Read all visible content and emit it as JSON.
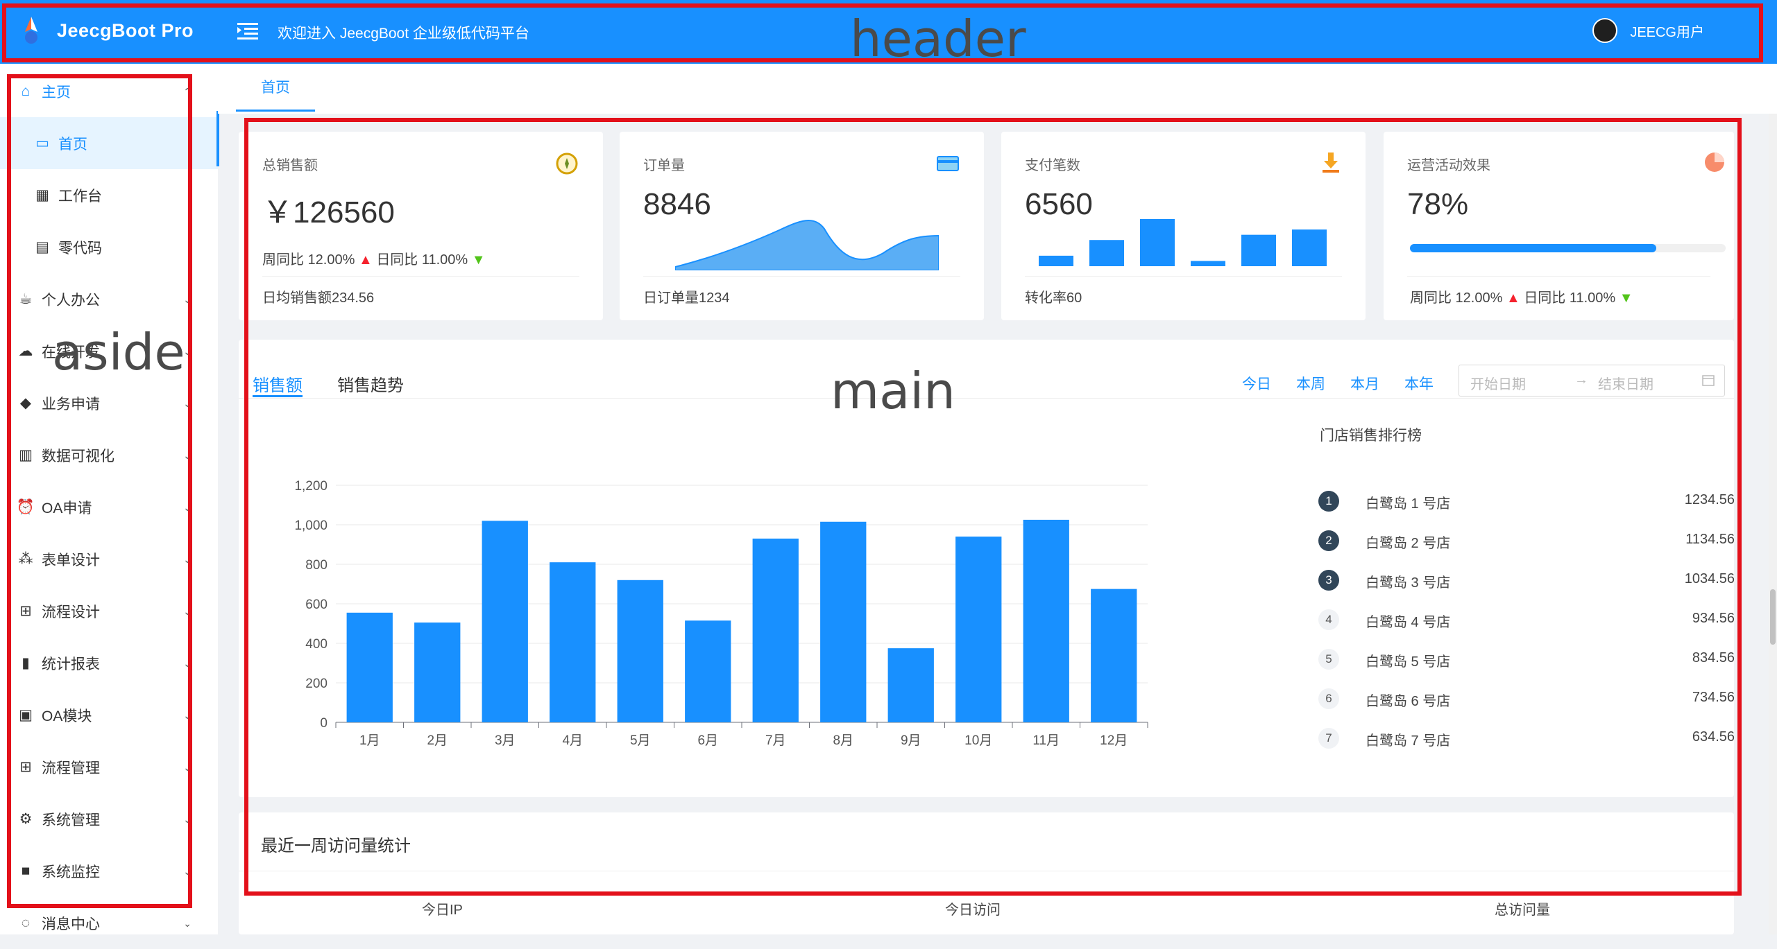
{
  "header": {
    "app_title": "JeecgBoot Pro",
    "welcome_text": "欢迎进入 JeecgBoot 企业级低代码平台",
    "user_name": "JEECG用户"
  },
  "annotations": {
    "header": "header",
    "aside": "aside",
    "main": "main"
  },
  "sidebar": {
    "items": [
      {
        "label": "主页",
        "icon": "home-icon"
      },
      {
        "label": "首页",
        "icon": "dashboard-icon"
      },
      {
        "label": "工作台",
        "icon": "grid-icon"
      },
      {
        "label": "零代码",
        "icon": "table-icon"
      },
      {
        "label": "个人办公",
        "icon": "coffee-icon"
      },
      {
        "label": "在线开发",
        "icon": "cloud-icon"
      },
      {
        "label": "业务申请",
        "icon": "tag-icon"
      },
      {
        "label": "数据可视化",
        "icon": "layout-icon"
      },
      {
        "label": "OA申请",
        "icon": "alarm-icon"
      },
      {
        "label": "表单设计",
        "icon": "cluster-icon"
      },
      {
        "label": "流程设计",
        "icon": "flow-icon"
      },
      {
        "label": "统计报表",
        "icon": "bar-chart-icon"
      },
      {
        "label": "OA模块",
        "icon": "audit-icon"
      },
      {
        "label": "流程管理",
        "icon": "flow-icon"
      },
      {
        "label": "系统管理",
        "icon": "setting-icon"
      },
      {
        "label": "系统监控",
        "icon": "monitor-icon"
      },
      {
        "label": "消息中心",
        "icon": "message-icon"
      }
    ]
  },
  "tabs": {
    "home": "首页"
  },
  "stats": {
    "sales": {
      "title": "总销售额",
      "value": "￥126560",
      "week": "周同比 12.00%",
      "day": "日同比 11.00%",
      "footer": "日均销售额234.56"
    },
    "orders": {
      "title": "订单量",
      "value": "8846",
      "footer": "日订单量1234"
    },
    "payments": {
      "title": "支付笔数",
      "value": "6560",
      "footer": "转化率60",
      "bars": [
        2,
        5,
        9,
        1,
        6,
        7
      ]
    },
    "operations": {
      "title": "运营活动效果",
      "value": "78%",
      "progress": 0.78,
      "week": "周同比 12.00%",
      "day": "日同比 11.00%"
    }
  },
  "sales_panel": {
    "tabs": [
      "销售额",
      "销售趋势"
    ],
    "periods": [
      "今日",
      "本周",
      "本月",
      "本年"
    ],
    "start_placeholder": "开始日期",
    "end_placeholder": "结束日期",
    "ranking_title": "门店销售排行榜",
    "ranking": [
      {
        "rank": "1",
        "name": "白鹭岛 1 号店",
        "value": "1234.56"
      },
      {
        "rank": "2",
        "name": "白鹭岛 2 号店",
        "value": "1134.56"
      },
      {
        "rank": "3",
        "name": "白鹭岛 3 号店",
        "value": "1034.56"
      },
      {
        "rank": "4",
        "name": "白鹭岛 4 号店",
        "value": "934.56"
      },
      {
        "rank": "5",
        "name": "白鹭岛 5 号店",
        "value": "834.56"
      },
      {
        "rank": "6",
        "name": "白鹭岛 6 号店",
        "value": "734.56"
      },
      {
        "rank": "7",
        "name": "白鹭岛 7 号店",
        "value": "634.56"
      }
    ]
  },
  "chart_data": {
    "type": "bar",
    "categories": [
      "1月",
      "2月",
      "3月",
      "4月",
      "5月",
      "6月",
      "7月",
      "8月",
      "9月",
      "10月",
      "11月",
      "12月"
    ],
    "values": [
      555,
      505,
      1020,
      810,
      720,
      515,
      930,
      1015,
      375,
      940,
      1025,
      675
    ],
    "ylim": [
      0,
      1200
    ],
    "yticks": [
      "0",
      "200",
      "400",
      "600",
      "800",
      "1,000",
      "1,200"
    ],
    "color": "#1890ff",
    "grid": true
  },
  "visits": {
    "title": "最近一周访问量统计",
    "labels": [
      "今日IP",
      "今日访问",
      "总访问量"
    ]
  },
  "colors": {
    "primary": "#1890ff",
    "annotation": "#e3101a"
  }
}
